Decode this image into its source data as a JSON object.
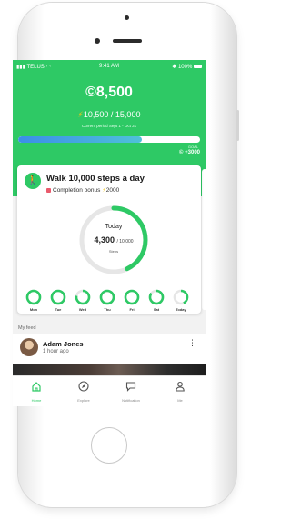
{
  "status_bar": {
    "carrier": "TELUS",
    "time": "9:41 AM",
    "battery": "100%"
  },
  "wallet": {
    "coin_symbol": "©",
    "balance": "8,500",
    "energy_current": "10,500",
    "energy_total": "15,000",
    "period": "Current period Sept 1 - Oct 31",
    "progress_fraction": 0.68,
    "goal_label": "GOAL",
    "goal_reward": "© +3000"
  },
  "task": {
    "title": "Walk 10,000 steps a day",
    "bonus_label": "Completion bonus",
    "bonus_value": "2000",
    "today_label": "Today",
    "steps_current": "4,300",
    "steps_goal": "/ 10,000",
    "steps_unit": "Steps",
    "progress_fraction": 0.43
  },
  "week": [
    {
      "day": "Mon",
      "fraction": 1.0
    },
    {
      "day": "Tue",
      "fraction": 1.0
    },
    {
      "day": "Wed",
      "fraction": 0.78
    },
    {
      "day": "Thu",
      "fraction": 1.0
    },
    {
      "day": "Fri",
      "fraction": 1.0
    },
    {
      "day": "Sat",
      "fraction": 0.85
    },
    {
      "day": "Today",
      "fraction": 0.43
    }
  ],
  "feed": {
    "section_label": "My feed",
    "post": {
      "author": "Adam Jones",
      "time": "1 hour ago"
    }
  },
  "tabs": [
    {
      "label": "Home",
      "icon": "home-icon",
      "active": true
    },
    {
      "label": "Explore",
      "icon": "compass-icon",
      "active": false
    },
    {
      "label": "Notification",
      "icon": "chat-icon",
      "active": false
    },
    {
      "label": "Me",
      "icon": "person-icon",
      "active": false
    }
  ],
  "colors": {
    "brand_green": "#2ec965",
    "progress_blue": "#3b8ee8",
    "ring_track": "#e6e6e6",
    "tab_active": "#2ec965",
    "tab_inactive": "#555555"
  }
}
